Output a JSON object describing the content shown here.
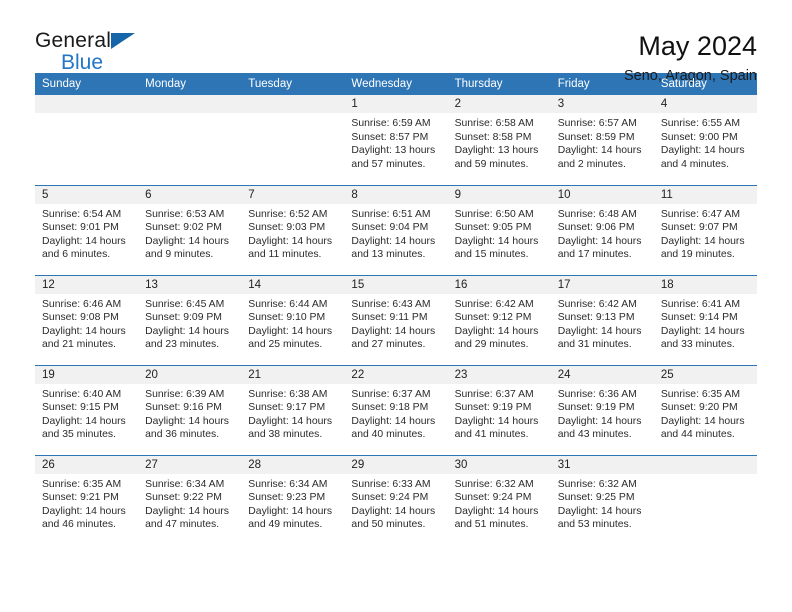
{
  "brand": {
    "name_top": "General",
    "name_bottom": "Blue",
    "triangle_color": "#1565a8",
    "blue_text_color": "#2176c7"
  },
  "header": {
    "title": "May 2024",
    "subtitle": "Seno, Aragon, Spain",
    "accent_color": "#2e75b6",
    "daynum_band_color": "#f1f1f1"
  },
  "weekday_headers": [
    "Sunday",
    "Monday",
    "Tuesday",
    "Wednesday",
    "Thursday",
    "Friday",
    "Saturday"
  ],
  "weeks": [
    [
      {
        "day": "",
        "sunrise": "",
        "sunset": "",
        "daylight": ""
      },
      {
        "day": "",
        "sunrise": "",
        "sunset": "",
        "daylight": ""
      },
      {
        "day": "",
        "sunrise": "",
        "sunset": "",
        "daylight": ""
      },
      {
        "day": "1",
        "sunrise": "Sunrise: 6:59 AM",
        "sunset": "Sunset: 8:57 PM",
        "daylight": "Daylight: 13 hours and 57 minutes."
      },
      {
        "day": "2",
        "sunrise": "Sunrise: 6:58 AM",
        "sunset": "Sunset: 8:58 PM",
        "daylight": "Daylight: 13 hours and 59 minutes."
      },
      {
        "day": "3",
        "sunrise": "Sunrise: 6:57 AM",
        "sunset": "Sunset: 8:59 PM",
        "daylight": "Daylight: 14 hours and 2 minutes."
      },
      {
        "day": "4",
        "sunrise": "Sunrise: 6:55 AM",
        "sunset": "Sunset: 9:00 PM",
        "daylight": "Daylight: 14 hours and 4 minutes."
      }
    ],
    [
      {
        "day": "5",
        "sunrise": "Sunrise: 6:54 AM",
        "sunset": "Sunset: 9:01 PM",
        "daylight": "Daylight: 14 hours and 6 minutes."
      },
      {
        "day": "6",
        "sunrise": "Sunrise: 6:53 AM",
        "sunset": "Sunset: 9:02 PM",
        "daylight": "Daylight: 14 hours and 9 minutes."
      },
      {
        "day": "7",
        "sunrise": "Sunrise: 6:52 AM",
        "sunset": "Sunset: 9:03 PM",
        "daylight": "Daylight: 14 hours and 11 minutes."
      },
      {
        "day": "8",
        "sunrise": "Sunrise: 6:51 AM",
        "sunset": "Sunset: 9:04 PM",
        "daylight": "Daylight: 14 hours and 13 minutes."
      },
      {
        "day": "9",
        "sunrise": "Sunrise: 6:50 AM",
        "sunset": "Sunset: 9:05 PM",
        "daylight": "Daylight: 14 hours and 15 minutes."
      },
      {
        "day": "10",
        "sunrise": "Sunrise: 6:48 AM",
        "sunset": "Sunset: 9:06 PM",
        "daylight": "Daylight: 14 hours and 17 minutes."
      },
      {
        "day": "11",
        "sunrise": "Sunrise: 6:47 AM",
        "sunset": "Sunset: 9:07 PM",
        "daylight": "Daylight: 14 hours and 19 minutes."
      }
    ],
    [
      {
        "day": "12",
        "sunrise": "Sunrise: 6:46 AM",
        "sunset": "Sunset: 9:08 PM",
        "daylight": "Daylight: 14 hours and 21 minutes."
      },
      {
        "day": "13",
        "sunrise": "Sunrise: 6:45 AM",
        "sunset": "Sunset: 9:09 PM",
        "daylight": "Daylight: 14 hours and 23 minutes."
      },
      {
        "day": "14",
        "sunrise": "Sunrise: 6:44 AM",
        "sunset": "Sunset: 9:10 PM",
        "daylight": "Daylight: 14 hours and 25 minutes."
      },
      {
        "day": "15",
        "sunrise": "Sunrise: 6:43 AM",
        "sunset": "Sunset: 9:11 PM",
        "daylight": "Daylight: 14 hours and 27 minutes."
      },
      {
        "day": "16",
        "sunrise": "Sunrise: 6:42 AM",
        "sunset": "Sunset: 9:12 PM",
        "daylight": "Daylight: 14 hours and 29 minutes."
      },
      {
        "day": "17",
        "sunrise": "Sunrise: 6:42 AM",
        "sunset": "Sunset: 9:13 PM",
        "daylight": "Daylight: 14 hours and 31 minutes."
      },
      {
        "day": "18",
        "sunrise": "Sunrise: 6:41 AM",
        "sunset": "Sunset: 9:14 PM",
        "daylight": "Daylight: 14 hours and 33 minutes."
      }
    ],
    [
      {
        "day": "19",
        "sunrise": "Sunrise: 6:40 AM",
        "sunset": "Sunset: 9:15 PM",
        "daylight": "Daylight: 14 hours and 35 minutes."
      },
      {
        "day": "20",
        "sunrise": "Sunrise: 6:39 AM",
        "sunset": "Sunset: 9:16 PM",
        "daylight": "Daylight: 14 hours and 36 minutes."
      },
      {
        "day": "21",
        "sunrise": "Sunrise: 6:38 AM",
        "sunset": "Sunset: 9:17 PM",
        "daylight": "Daylight: 14 hours and 38 minutes."
      },
      {
        "day": "22",
        "sunrise": "Sunrise: 6:37 AM",
        "sunset": "Sunset: 9:18 PM",
        "daylight": "Daylight: 14 hours and 40 minutes."
      },
      {
        "day": "23",
        "sunrise": "Sunrise: 6:37 AM",
        "sunset": "Sunset: 9:19 PM",
        "daylight": "Daylight: 14 hours and 41 minutes."
      },
      {
        "day": "24",
        "sunrise": "Sunrise: 6:36 AM",
        "sunset": "Sunset: 9:19 PM",
        "daylight": "Daylight: 14 hours and 43 minutes."
      },
      {
        "day": "25",
        "sunrise": "Sunrise: 6:35 AM",
        "sunset": "Sunset: 9:20 PM",
        "daylight": "Daylight: 14 hours and 44 minutes."
      }
    ],
    [
      {
        "day": "26",
        "sunrise": "Sunrise: 6:35 AM",
        "sunset": "Sunset: 9:21 PM",
        "daylight": "Daylight: 14 hours and 46 minutes."
      },
      {
        "day": "27",
        "sunrise": "Sunrise: 6:34 AM",
        "sunset": "Sunset: 9:22 PM",
        "daylight": "Daylight: 14 hours and 47 minutes."
      },
      {
        "day": "28",
        "sunrise": "Sunrise: 6:34 AM",
        "sunset": "Sunset: 9:23 PM",
        "daylight": "Daylight: 14 hours and 49 minutes."
      },
      {
        "day": "29",
        "sunrise": "Sunrise: 6:33 AM",
        "sunset": "Sunset: 9:24 PM",
        "daylight": "Daylight: 14 hours and 50 minutes."
      },
      {
        "day": "30",
        "sunrise": "Sunrise: 6:32 AM",
        "sunset": "Sunset: 9:24 PM",
        "daylight": "Daylight: 14 hours and 51 minutes."
      },
      {
        "day": "31",
        "sunrise": "Sunrise: 6:32 AM",
        "sunset": "Sunset: 9:25 PM",
        "daylight": "Daylight: 14 hours and 53 minutes."
      },
      {
        "day": "",
        "sunrise": "",
        "sunset": "",
        "daylight": ""
      }
    ]
  ]
}
